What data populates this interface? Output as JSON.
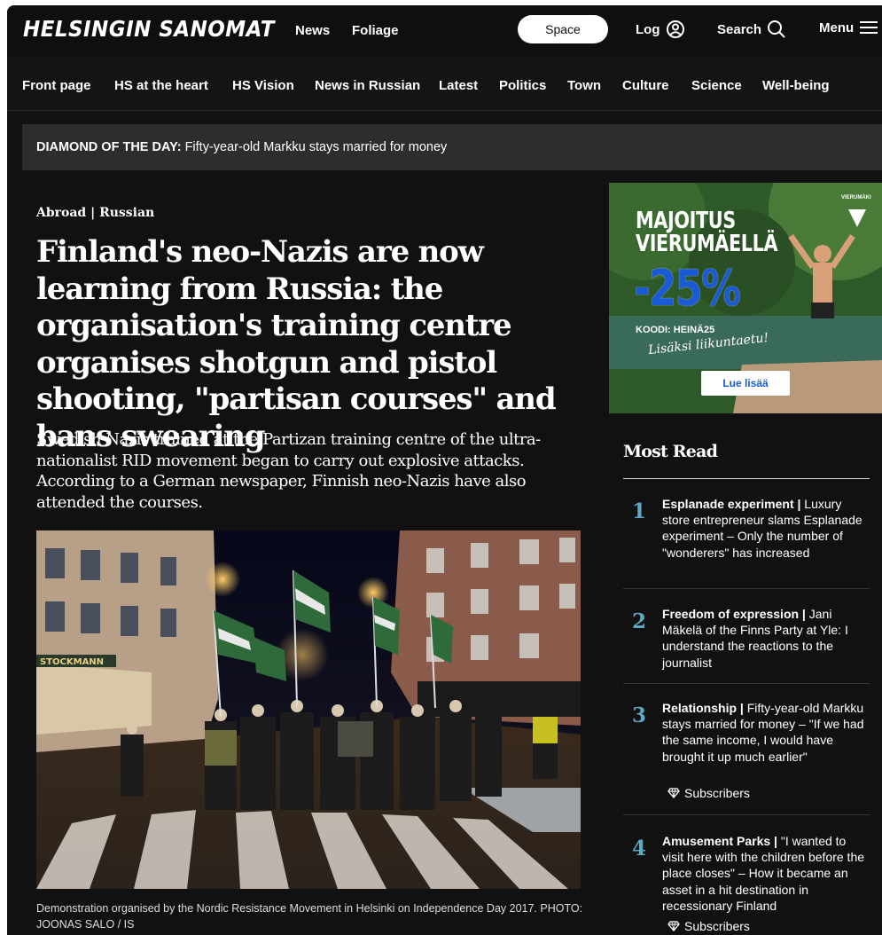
{
  "header": {
    "logo": "HELSINGIN SANOMAT",
    "links": [
      "News",
      "Foliage"
    ],
    "space_label": "Space",
    "log_label": "Log",
    "search_label": "Search",
    "menu_label": "Menu"
  },
  "sections": [
    "Front page",
    "HS at the heart",
    "HS Vision",
    "News in Russian",
    "Latest",
    "Politics",
    "Town",
    "Culture",
    "Science",
    "Well-being"
  ],
  "diamond": {
    "label": "DIAMOND OF THE DAY:",
    "text": "Fifty-year-old Markku stays married for money"
  },
  "article": {
    "kicker": "Abroad | Russian",
    "headline": "Finland's neo-Nazis are now learning from Russia: the organisation's training centre organises shotgun and pistol shooting, \"partisan courses\" and bans swearing",
    "lead": "Swedish Nazis trained at the Partizan training centre of the ultra-nationalist RID movement began to carry out explosive attacks. According to a German newspaper, Finnish neo-Nazis have also attended the courses.",
    "caption": "Demonstration organised by the Nordic Resistance Movement in Helsinki on Independence Day 2017. PHOTO: JOONAS SALO / IS"
  },
  "ad": {
    "line1": "MAJOITUS",
    "line2": "VIERUMÄELLÄ",
    "discount": "-25%",
    "code": "KOODI: HEINÄ25",
    "script": "Lisäksi liikuntaetu!",
    "button": "Lue lisää",
    "brand": "VIERUMÄKI"
  },
  "most_read": {
    "title": "Most Read",
    "items": [
      {
        "num": "1",
        "category": "Esplanade experiment |",
        "text": " Luxury store entrepreneur slams Esplanade experiment – Only the number of \"wonderers\" has increased",
        "subscribers": ""
      },
      {
        "num": "2",
        "category": "Freedom of expression |",
        "text": " Jani Mäkelä of the Finns Party at Yle: I understand the reactions to the journalist",
        "subscribers": ""
      },
      {
        "num": "3",
        "category": "Relationship |",
        "text": " Fifty-year-old Markku stays married for money – \"If we had the same income, I would have brought it up much earlier\"",
        "subscribers": "Subscribers"
      },
      {
        "num": "4",
        "category": "Amusement Parks |",
        "text": " \"I wanted to visit here with the children before the place closes\" – How it became an asset in a hit destination in recessionary Finland",
        "subscribers": "Subscribers"
      }
    ]
  },
  "colors": {
    "background": "#111111",
    "accent_number": "#5fa8c4",
    "ad_blue": "#1a5ad4",
    "diamond_bar": "#2d2d2d"
  }
}
